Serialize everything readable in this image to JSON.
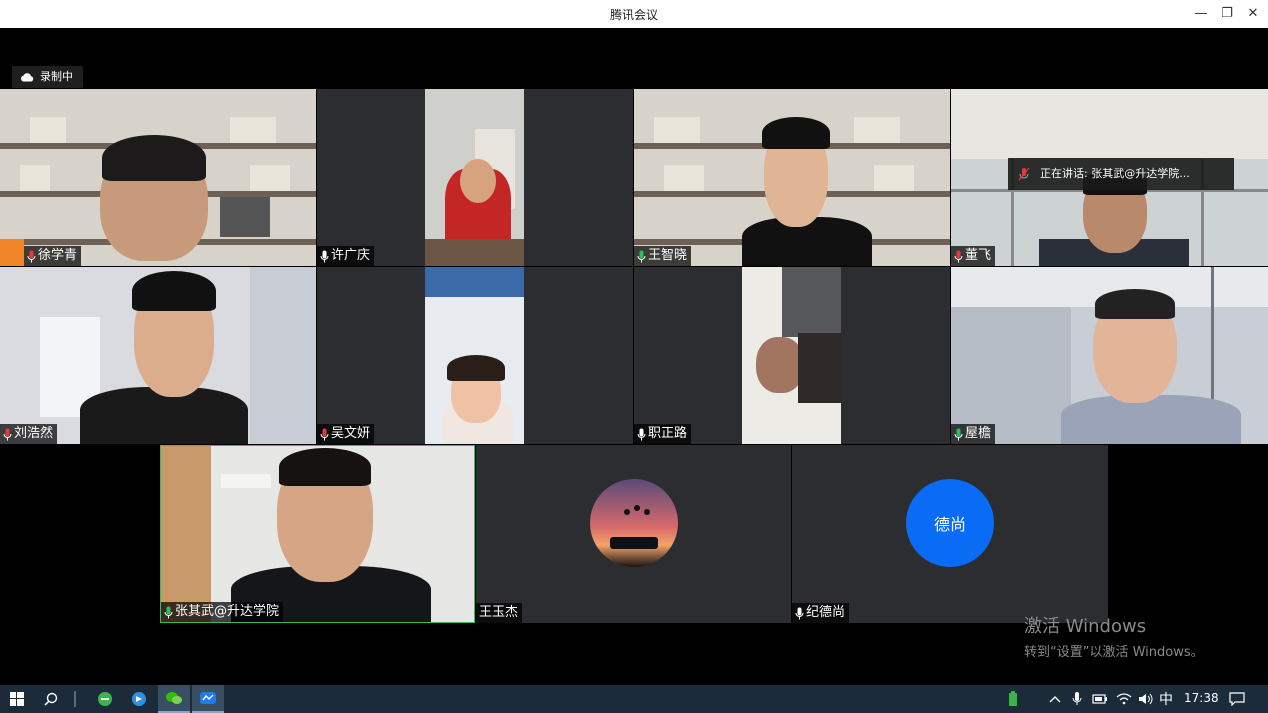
{
  "window": {
    "title": "腾讯会议"
  },
  "recording": {
    "label": "录制中"
  },
  "speaking": {
    "text": "正在讲话: 张其武@升达学院..."
  },
  "participants": [
    {
      "name": "徐学青"
    },
    {
      "name": "许广庆"
    },
    {
      "name": "王智晓"
    },
    {
      "name": "董飞"
    },
    {
      "name": "刘浩然"
    },
    {
      "name": "吴文妍"
    },
    {
      "name": "职正路"
    },
    {
      "name": "屋檐"
    },
    {
      "name": "张其武@升达学院"
    },
    {
      "name": "王玉杰"
    },
    {
      "name": "纪德尚",
      "avatar_text": "德尚"
    }
  ],
  "watermark": {
    "line1": "激活 Windows",
    "line2": "转到“设置”以激活 Windows。"
  },
  "taskbar": {
    "ime": "中",
    "time": "17:38"
  },
  "colors": {
    "accent_blue": "#0a6cf5",
    "active_speaker_border": "#3cbb5b",
    "mic_green": "#29c25a",
    "mic_muted_red": "#e23b3b"
  }
}
